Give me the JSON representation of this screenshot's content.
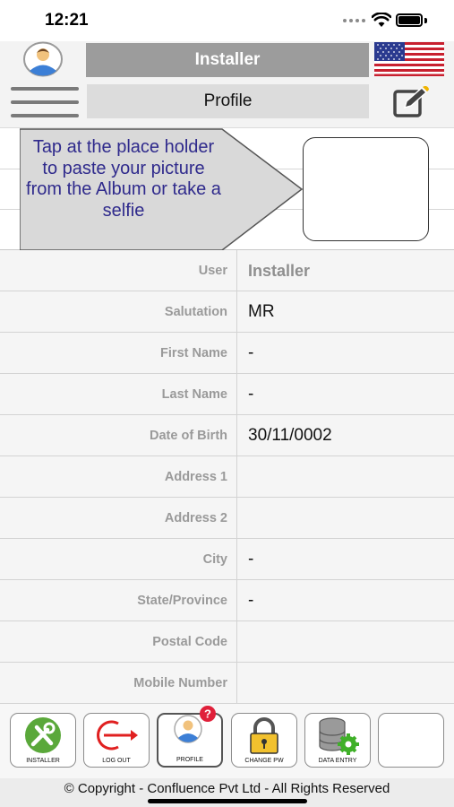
{
  "status_bar": {
    "time": "12:21"
  },
  "header": {
    "title": "Installer",
    "subtitle": "Profile"
  },
  "photo": {
    "instruction": "Tap at the place holder to paste your picture from the Album or take a selfie"
  },
  "form": {
    "rows": [
      {
        "label": "User",
        "value": "Installer"
      },
      {
        "label": "Salutation",
        "value": "MR"
      },
      {
        "label": "First Name",
        "value": "-"
      },
      {
        "label": "Last Name",
        "value": "-"
      },
      {
        "label": "Date of Birth",
        "value": "30/11/0002"
      },
      {
        "label": "Address 1",
        "value": ""
      },
      {
        "label": "Address 2",
        "value": ""
      },
      {
        "label": "City",
        "value": "-"
      },
      {
        "label": "State/Province",
        "value": "-"
      },
      {
        "label": "Postal Code",
        "value": ""
      },
      {
        "label": "Mobile Number",
        "value": ""
      }
    ]
  },
  "toolbar": {
    "items": [
      {
        "label": "INSTALLER",
        "icon": "installer-tools-icon"
      },
      {
        "label": "LOG OUT",
        "icon": "logout-icon"
      },
      {
        "label": "PROFILE",
        "icon": "profile-help-icon"
      },
      {
        "label": "CHANGE PW",
        "icon": "padlock-icon"
      },
      {
        "label": "DATA ENTRY",
        "icon": "database-gear-icon"
      },
      {
        "label": "",
        "icon": ""
      }
    ]
  },
  "footer": {
    "copyright": "© Copyright - Confluence Pvt Ltd - All Rights Reserved"
  },
  "colors": {
    "title_bg": "#9c9c9c",
    "callout_text": "#2f2a8c",
    "installer_green": "#5aa83a",
    "logout_red": "#e02020",
    "alert_red": "#e0203a"
  }
}
